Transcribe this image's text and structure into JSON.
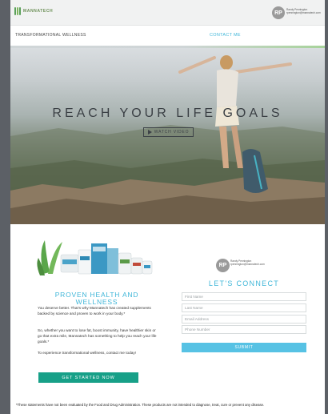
{
  "header": {
    "logo_text": "MANNATECH",
    "user_initials": "RP",
    "user_name": "Randy Pennington",
    "user_email": "rpennington@mannatech.com"
  },
  "nav": {
    "brand": "TRANSFORMATIONAL WELLNESS",
    "contact_label": "CONTACT ME"
  },
  "hero": {
    "title": "REACH YOUR LIFE GOALS",
    "watch_label": "WATCH VIDEO"
  },
  "left": {
    "title": "PROVEN HEALTH AND WELLNESS",
    "paragraph1": "You deserve better. That's why Mannatech has created supplements backed by science and proven to work in your body.*",
    "paragraph2": "So, whether you want to lose fat, boost immunity, have healthier skin or go that extra mile, Mannatech has something to help you reach your life goals.*",
    "paragraph3": "To experience transformational wellness, contact me today!",
    "cta_label": "GET STARTED NOW"
  },
  "form": {
    "user_initials": "RP",
    "user_name": "Randy Pennington",
    "user_email": "rpennington@mannatech.com",
    "title": "LET'S CONNECT",
    "first_name_placeholder": "First Name",
    "last_name_placeholder": "Last Name",
    "email_placeholder": "Email Address",
    "phone_placeholder": "Phone Number",
    "submit_label": "SUBMIT"
  },
  "footer": {
    "disclaimer": "*These statements have not been evaluated by the Food and Drug Administration. These products are not intended to diagnose, treat, cure or prevent any disease."
  },
  "colors": {
    "accent_blue": "#3fb6d8",
    "cta_green": "#17a088",
    "submit_blue": "#57c2e4"
  }
}
